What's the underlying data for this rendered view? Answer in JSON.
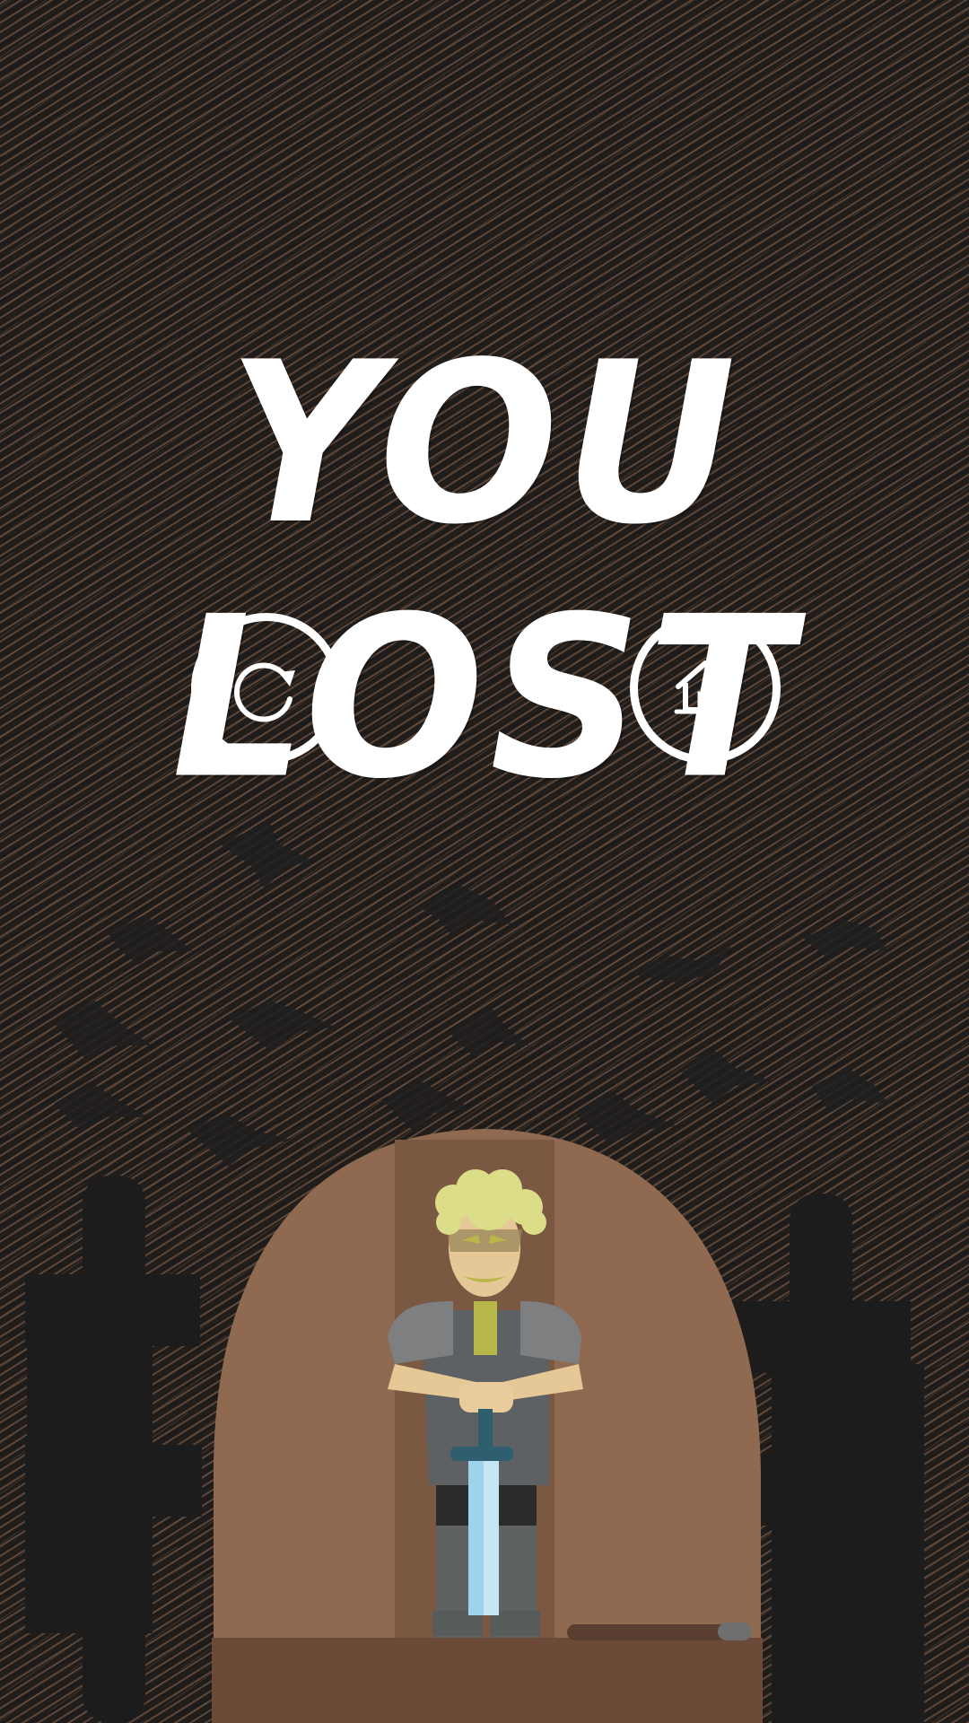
{
  "screen": {
    "title": "YOU LOST"
  },
  "buttons": {
    "retry": {
      "icon": "retry-icon"
    },
    "home": {
      "icon": "home-icon"
    }
  },
  "colors": {
    "background": "#201d1b",
    "scribble": "#8c6850",
    "cave": "#8f6a50",
    "cave_floor": "#6b4a38",
    "title": "#ffffff"
  }
}
